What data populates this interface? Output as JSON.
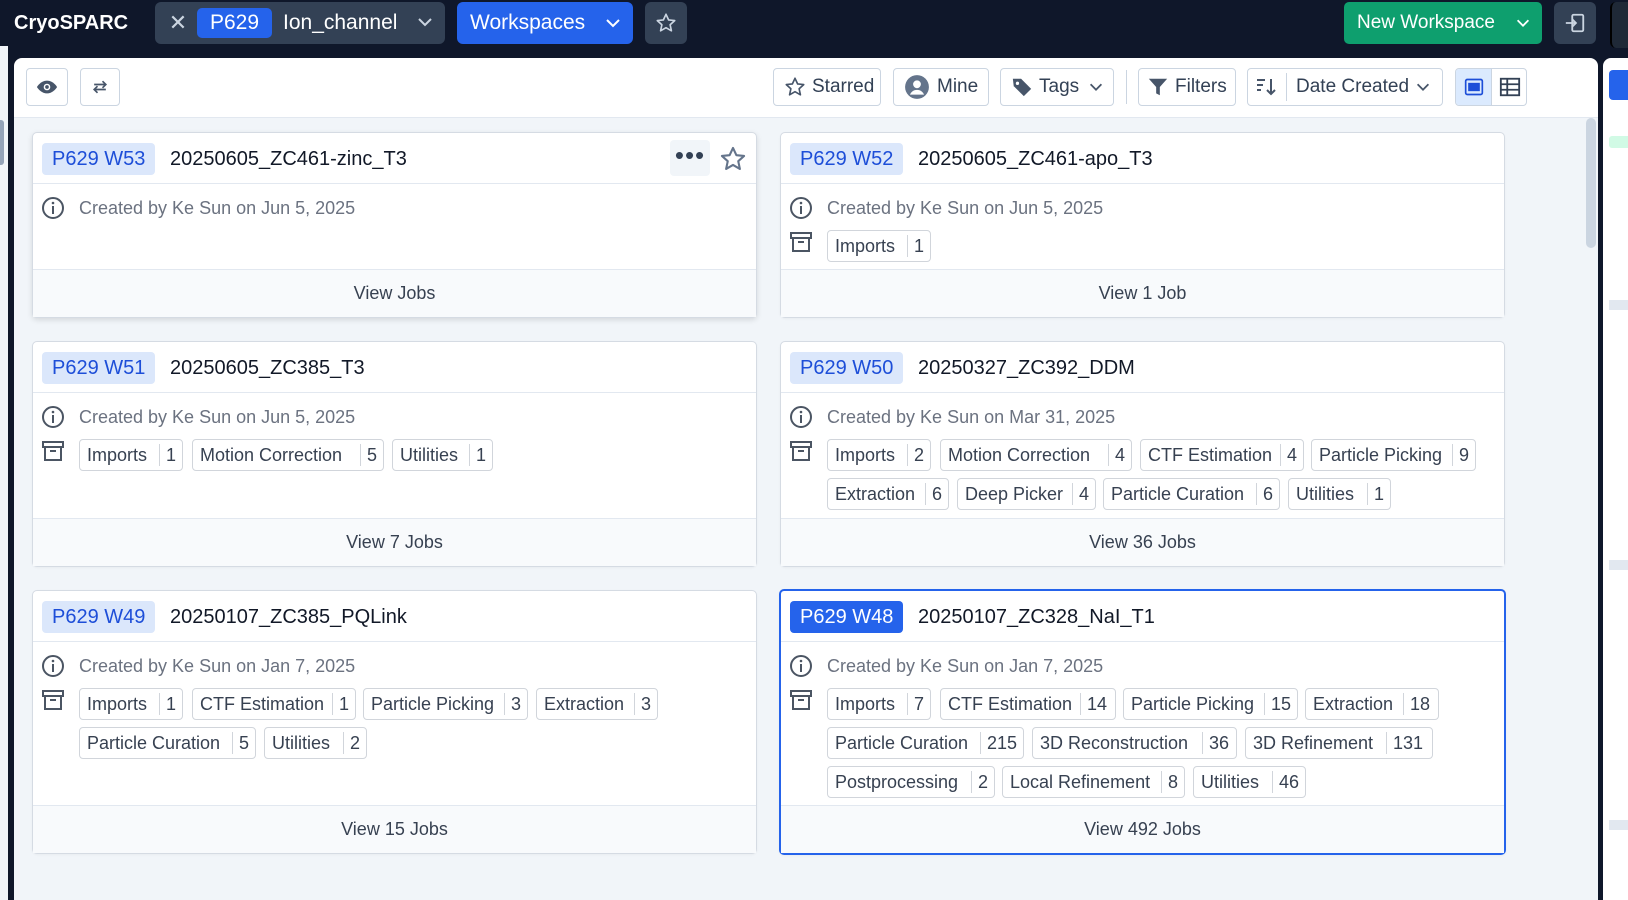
{
  "app": {
    "title": "CryoSPARC"
  },
  "project": {
    "id": "P629",
    "name": "Ion_channel"
  },
  "nav": {
    "workspaces_label": "Workspaces",
    "new_workspace_label": "New Workspace"
  },
  "toolbar": {
    "starred_label": "Starred",
    "mine_label": "Mine",
    "tags_label": "Tags",
    "filters_label": "Filters",
    "sort_label": "Date Created"
  },
  "colors": {
    "accent": "#2563eb",
    "success": "#0e9f6e",
    "dark": "#0f172a"
  },
  "workspaces": [
    {
      "id": "P629 W53",
      "title": "20250605_ZC461-zinc_T3",
      "created": "Created by Ke Sun on Jun 5, 2025",
      "chips": [],
      "footer": "View Jobs"
    },
    {
      "id": "P629 W52",
      "title": "20250605_ZC461-apo_T3",
      "created": "Created by Ke Sun on Jun 5, 2025",
      "chips": [
        {
          "label": "Imports",
          "count": "1"
        }
      ],
      "footer": "View 1 Job"
    },
    {
      "id": "P629 W51",
      "title": "20250605_ZC385_T3",
      "created": "Created by Ke Sun on Jun 5, 2025",
      "chips": [
        {
          "label": "Imports",
          "count": "1"
        },
        {
          "label": "Motion Correction",
          "count": "5"
        },
        {
          "label": "Utilities",
          "count": "1"
        }
      ],
      "footer": "View 7 Jobs"
    },
    {
      "id": "P629 W50",
      "title": "20250327_ZC392_DDM",
      "created": "Created by Ke Sun on Mar 31, 2025",
      "chips": [
        {
          "label": "Imports",
          "count": "2"
        },
        {
          "label": "Motion Correction",
          "count": "4"
        },
        {
          "label": "CTF Estimation",
          "count": "4"
        },
        {
          "label": "Particle Picking",
          "count": "9"
        },
        {
          "label": "Extraction",
          "count": "6"
        },
        {
          "label": "Deep Picker",
          "count": "4"
        },
        {
          "label": "Particle Curation",
          "count": "6"
        },
        {
          "label": "Utilities",
          "count": "1"
        }
      ],
      "footer": "View 36 Jobs"
    },
    {
      "id": "P629 W49",
      "title": "20250107_ZC385_PQLink",
      "created": "Created by Ke Sun on Jan 7, 2025",
      "chips": [
        {
          "label": "Imports",
          "count": "1"
        },
        {
          "label": "CTF Estimation",
          "count": "1"
        },
        {
          "label": "Particle Picking",
          "count": "3"
        },
        {
          "label": "Extraction",
          "count": "3"
        },
        {
          "label": "Particle Curation",
          "count": "5"
        },
        {
          "label": "Utilities",
          "count": "2"
        }
      ],
      "footer": "View 15 Jobs"
    },
    {
      "id": "P629 W48",
      "title": "20250107_ZC328_NaI_T1",
      "created": "Created by Ke Sun on Jan 7, 2025",
      "chips": [
        {
          "label": "Imports",
          "count": "7"
        },
        {
          "label": "CTF Estimation",
          "count": "14"
        },
        {
          "label": "Particle Picking",
          "count": "15"
        },
        {
          "label": "Extraction",
          "count": "18"
        },
        {
          "label": "Particle Curation",
          "count": "215"
        },
        {
          "label": "3D Reconstruction",
          "count": "36"
        },
        {
          "label": "3D Refinement",
          "count": "131"
        },
        {
          "label": "Postprocessing",
          "count": "2"
        },
        {
          "label": "Local Refinement",
          "count": "8"
        },
        {
          "label": "Utilities",
          "count": "46"
        }
      ],
      "footer": "View 492 Jobs"
    }
  ]
}
